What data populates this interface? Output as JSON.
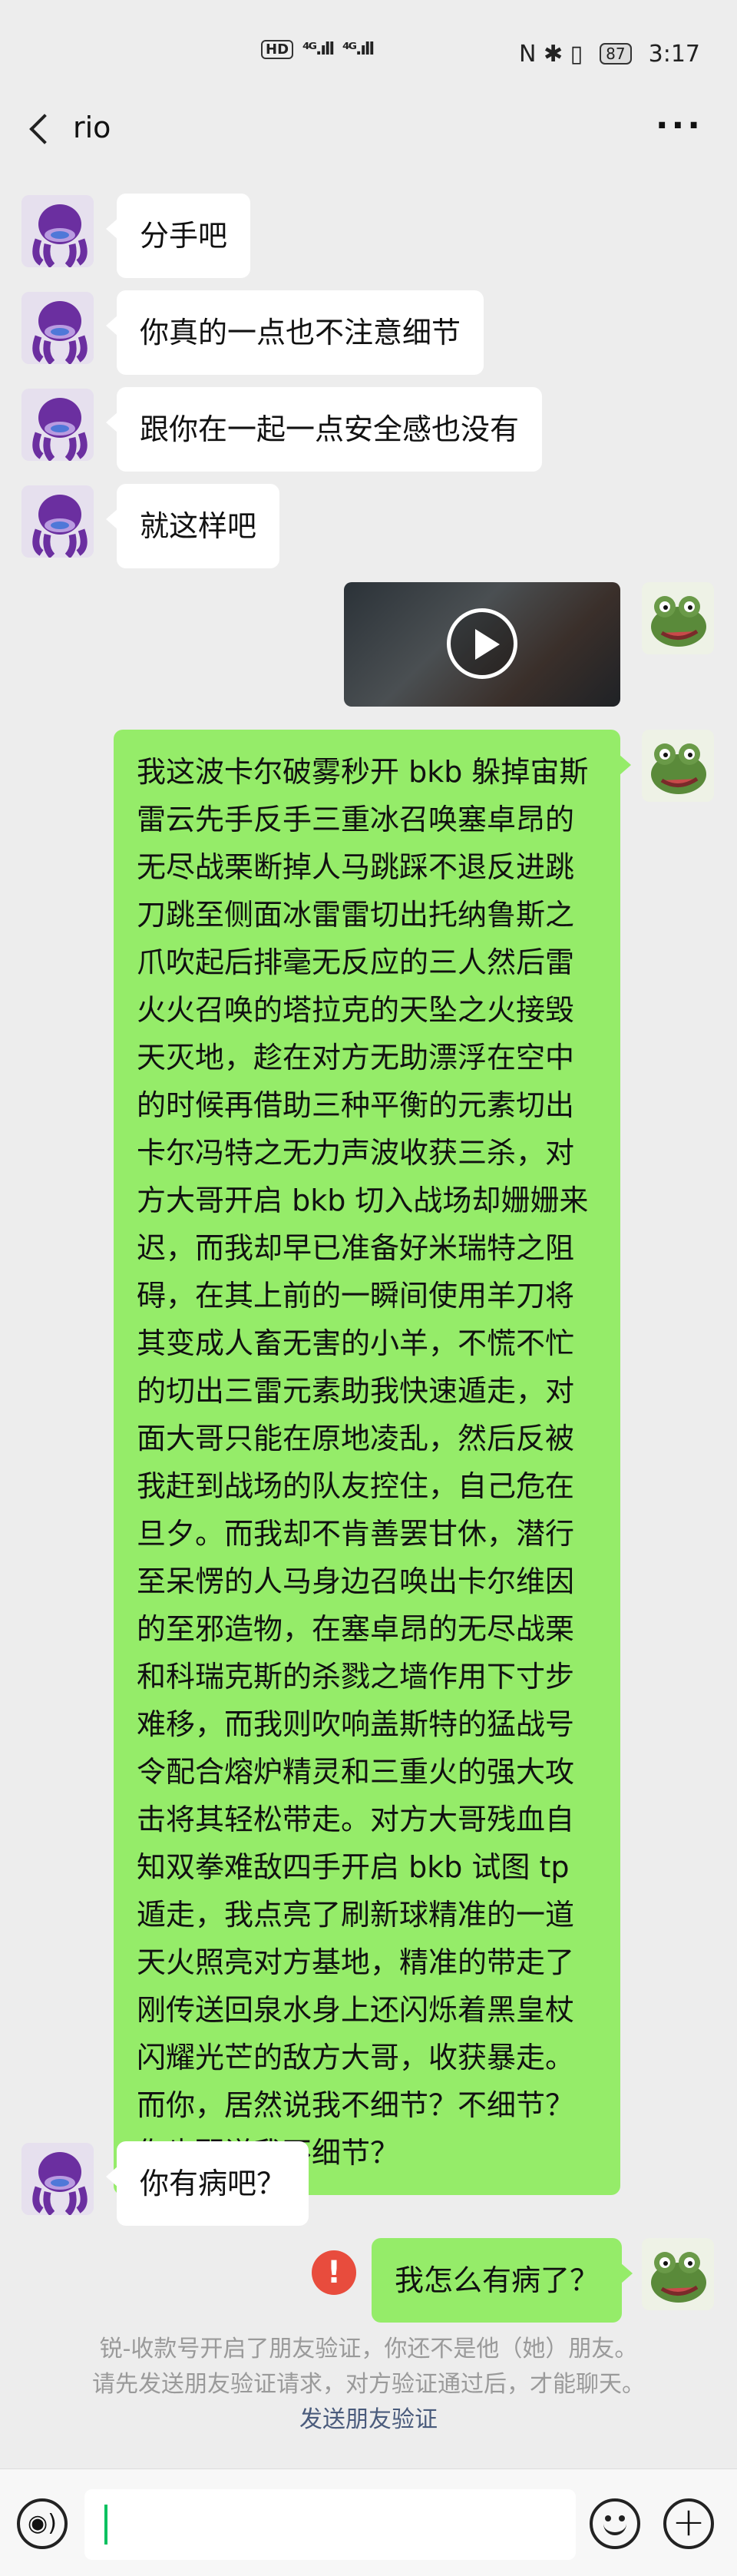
{
  "status_bar": {
    "network_badge": "HD",
    "signal_1": "⁴ᴳ.ıll",
    "signal_2": "⁴ᴳ.ıll",
    "icons": "N ✱ ▯",
    "battery": "87",
    "time": "3:17"
  },
  "header": {
    "back_icon": "chevron-left-icon",
    "title": "rio",
    "more_label": "···"
  },
  "messages": [
    {
      "side": "in",
      "text": "分手吧"
    },
    {
      "side": "in",
      "text": "你真的一点也不注意细节"
    },
    {
      "side": "in",
      "text": "跟你在一起一点安全感也没有"
    },
    {
      "side": "in",
      "text": "就这样吧"
    },
    {
      "side": "out",
      "type": "video"
    },
    {
      "side": "out",
      "text": "我这波卡尔破雾秒开 bkb 躲掉宙斯雷云先手反手三重冰召唤塞卓昂的无尽战栗断掉人马跳踩不退反进跳刀跳至侧面冰雷雷切出托纳鲁斯之爪吹起后排毫无反应的三人然后雷火火召唤的塔拉克的天坠之火接毁天灭地，趁在对方无助漂浮在空中的时候再借助三种平衡的元素切出卡尔冯特之无力声波收获三杀，对方大哥开启 bkb 切入战场却姗姗来迟，而我却早已准备好米瑞特之阻碍，在其上前的一瞬间使用羊刀将其变成人畜无害的小羊，不慌不忙的切出三雷元素助我快速遁走，对面大哥只能在原地凌乱，然后反被我赶到战场的队友控住，自己危在旦夕。而我却不肯善罢甘休，潜行至呆愣的人马身边召唤出卡尔维因的至邪造物，在塞卓昂的无尽战栗和科瑞克斯的杀戮之墙作用下寸步难移，而我则吹响盖斯特的猛战号令配合熔炉精灵和三重火的强大攻击将其轻松带走。对方大哥残血自知双拳难敌四手开启 bkb 试图 tp 遁走，我点亮了刷新球精准的一道天火照亮对方基地，精准的带走了刚传送回泉水身上还闪烁着黑皇杖闪耀光芒的敌方大哥，收获暴走。而你，居然说我不细节？不细节？你也配说我不细节？"
    },
    {
      "side": "in",
      "text": "你有病吧？"
    },
    {
      "side": "out",
      "text": "我怎么有病了？",
      "failed": true
    }
  ],
  "error_icon_label": "!",
  "system_notice": {
    "line1": "锐-收款号开启了朋友验证，你还不是他（她）朋友。",
    "line2": "请先发送朋友验证请求，对方验证通过后，才能聊天。",
    "link": "发送朋友验证"
  },
  "input_bar": {
    "voice_icon": "voice-icon",
    "emoji_icon": "emoji-icon",
    "plus_icon": "plus-icon",
    "plus_label": "+",
    "voice_label": "◉)"
  },
  "colors": {
    "background": "#ededed",
    "bubble_out": "#95ec69",
    "bubble_in": "#ffffff",
    "error": "#e84c3d",
    "link": "#4a5b7c"
  }
}
